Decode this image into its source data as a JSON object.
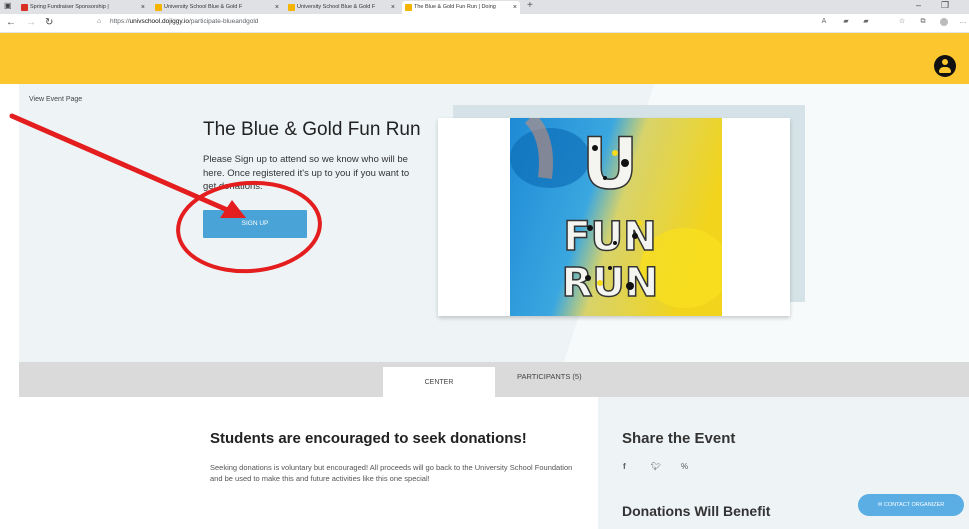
{
  "browser": {
    "tabs": [
      {
        "label": "Spring Fundraiser Sponsorship | ",
        "favicon_color": "#d93025"
      },
      {
        "label": "University School Blue & Gold F",
        "favicon_color": "#f4b400"
      },
      {
        "label": "University School Blue & Gold F",
        "favicon_color": "#f4b400"
      },
      {
        "label": "The Blue & Gold Fun Run | Doing",
        "favicon_color": "#f4b400"
      }
    ],
    "url_prefix": "https://",
    "url_host": "univschool.dojiggy.io",
    "url_path": "/participate-blueandgold",
    "colors": {
      "chrome": "#dfe1e5"
    }
  },
  "site": {
    "colors": {
      "brand_yellow": "#fcc62f",
      "accent_blue": "#4aa3d6",
      "hero_bg": "#eef4f6"
    },
    "view_event_link": "View Event Page",
    "event_title": "The Blue & Gold Fun Run",
    "description": "Please Sign up to attend so we know who will be here. Once registered it's up to you if you want to get donations.",
    "signup_button": "SIGN UP",
    "tabs": {
      "center": "CENTER",
      "participants": "PARTICIPANTS (5)"
    },
    "section_title": "Students are encouraged to seek donations!",
    "section_body": "Seeking donations is voluntary but encouraged!  All proceeds will go back to the University School Foundation and be used to make this and future activities like this one special!",
    "share_title": "Share the Event",
    "donations_title": "Donations Will Benefit",
    "contact_button": "CONTACT ORGANIZER",
    "poster_letters": [
      "U",
      "FUN",
      "RUN"
    ]
  },
  "annotation": {
    "color": "#e41e1e"
  }
}
